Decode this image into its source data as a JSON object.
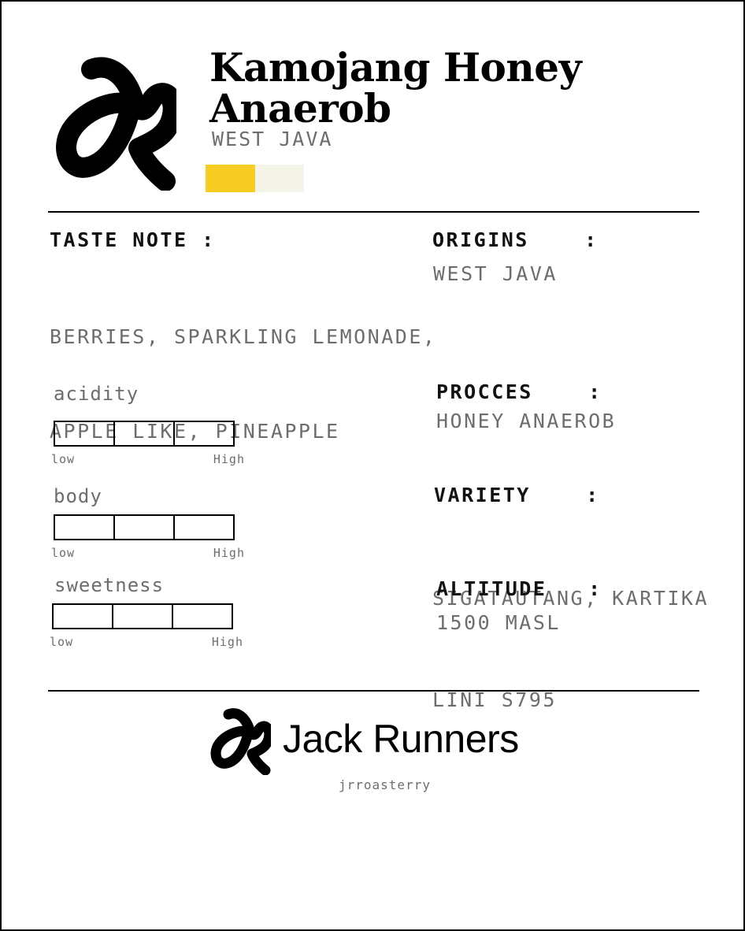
{
  "product": {
    "title_line1": "Kamojang Honey",
    "title_line2": "Anaerob",
    "region": "WEST JAVA",
    "roast_level_fraction": 0.5
  },
  "colors": {
    "roast_fill": "#f7cd23",
    "roast_track": "#f4f4e8",
    "ink": "#000000",
    "muted": "#6d6d6d"
  },
  "taste_note": {
    "label": "TASTE NOTE :",
    "line1": "BERRIES, SPARKLING LEMONADE,",
    "line2": "APPLE LIKE, PINEAPPLE"
  },
  "origins": {
    "label": "ORIGINS    :",
    "value": "WEST JAVA"
  },
  "process": {
    "label": "PROCCES    :",
    "value": "HONEY ANAEROB"
  },
  "variety": {
    "label": "VARIETY    :",
    "line1": "SIGATAUTANG, KARTIKA",
    "line2": "LINI S795"
  },
  "altitude": {
    "label": "ALTITUDE   :",
    "value": "1500 MASL"
  },
  "meters": [
    {
      "name": "acidity",
      "segments": 3,
      "filled": 0,
      "low": "low",
      "high": "High"
    },
    {
      "name": "body",
      "segments": 3,
      "filled": 0,
      "low": "low",
      "high": "High"
    },
    {
      "name": "sweetness",
      "segments": 3,
      "filled": 0,
      "low": "low",
      "high": "High"
    }
  ],
  "footer": {
    "brand": "Jack Runners",
    "handle": "jrroasterry",
    "logo_icon": "jr-logo-icon"
  },
  "header": {
    "logo_icon": "jr-logo-icon"
  }
}
